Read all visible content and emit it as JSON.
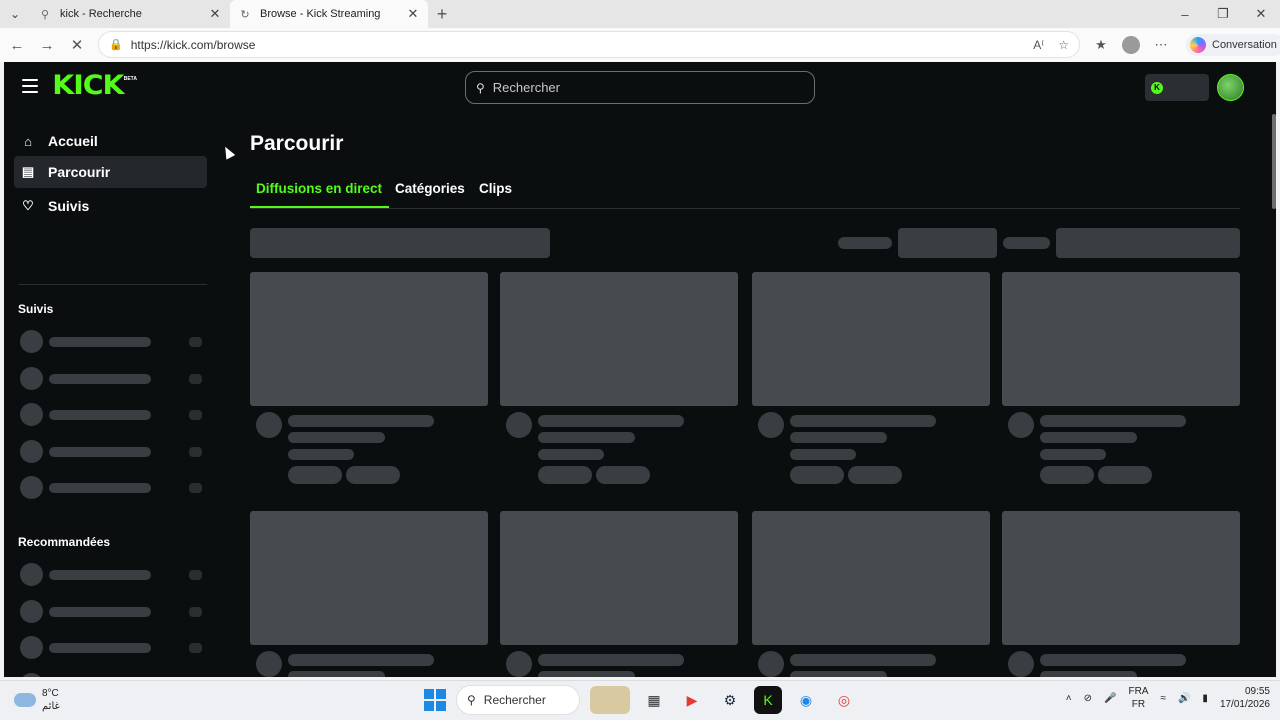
{
  "browser": {
    "tabs": [
      {
        "title": "kick - Recherche",
        "active": false,
        "icon": "search-icon"
      },
      {
        "title": "Browse - Kick Streaming",
        "active": true,
        "icon": "loading-icon"
      }
    ],
    "url": "https://kick.com/browse",
    "copilot_label": "Conversation"
  },
  "site": {
    "logo": "KICK",
    "logo_badge": "BETA",
    "search_placeholder": "Rechercher",
    "brand_color": "#53fc18"
  },
  "sidebar": {
    "nav": [
      {
        "label": "Accueil",
        "icon": "home-icon",
        "active": false
      },
      {
        "label": "Parcourir",
        "icon": "browse-icon",
        "active": true
      },
      {
        "label": "Suivis",
        "icon": "heart-icon",
        "active": false
      }
    ],
    "following_heading": "Suivis",
    "recommended_heading": "Recommandées"
  },
  "main": {
    "title": "Parcourir",
    "tabs": [
      {
        "label": "Diffusions en direct",
        "active": true
      },
      {
        "label": "Catégories",
        "active": false
      },
      {
        "label": "Clips",
        "active": false
      }
    ]
  },
  "taskbar": {
    "temperature": "8°C",
    "weather_desc": "غائم",
    "search_label": "Rechercher",
    "lang_top": "FRA",
    "lang_bottom": "FR",
    "time": "09:55",
    "date": "17/01/2026"
  }
}
